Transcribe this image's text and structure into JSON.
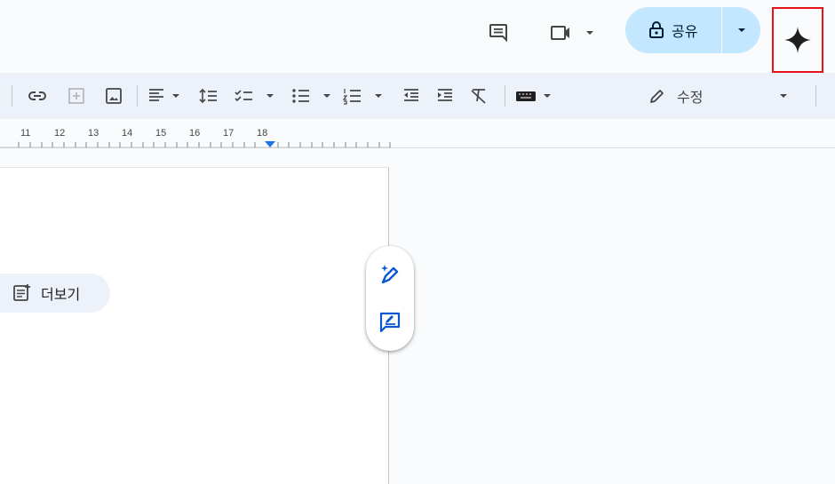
{
  "header": {
    "share_label": "공유",
    "icons": [
      "comment-icon",
      "video-call-icon",
      "lock-icon",
      "dropdown-arrow-icon",
      "gemini-sparkle-icon"
    ]
  },
  "toolbar": {
    "mode_label": "수정",
    "icons": [
      "link-icon",
      "add-comment-icon",
      "image-icon",
      "align-icon",
      "line-spacing-icon",
      "checklist-icon",
      "bulleted-list-icon",
      "numbered-list-icon",
      "decrease-indent-icon",
      "increase-indent-icon",
      "clear-formatting-icon",
      "input-tools-icon",
      "pencil-icon"
    ]
  },
  "ruler": {
    "numbers": [
      "11",
      "12",
      "13",
      "14",
      "15",
      "16",
      "17",
      "18"
    ]
  },
  "document": {
    "more_label": "더보기"
  },
  "floating_toolbar": {
    "icons": [
      "help-me-write-icon",
      "suggest-edits-icon"
    ]
  },
  "colors": {
    "accent": "#0b57d0",
    "share_bg": "#c2e7ff",
    "highlight_box": "#e8131a",
    "toolbar_bg": "#edf2fa"
  }
}
